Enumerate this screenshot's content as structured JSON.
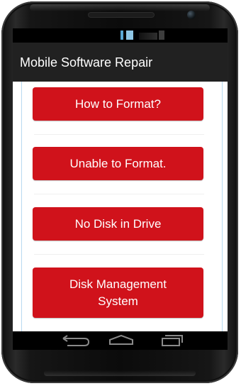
{
  "app": {
    "title": "Mobile Software Repair"
  },
  "menu": {
    "items": [
      {
        "label": "How to Format?"
      },
      {
        "label": "Unable to Format."
      },
      {
        "label": "No Disk in Drive"
      },
      {
        "label": "Disk Management System"
      }
    ]
  },
  "navigation": {
    "buttons": [
      "back-icon",
      "home-icon",
      "recent-apps-icon"
    ]
  },
  "colors": {
    "button_red": "#d0121b",
    "header_bg": "#212121",
    "status_bg": "#000000"
  }
}
